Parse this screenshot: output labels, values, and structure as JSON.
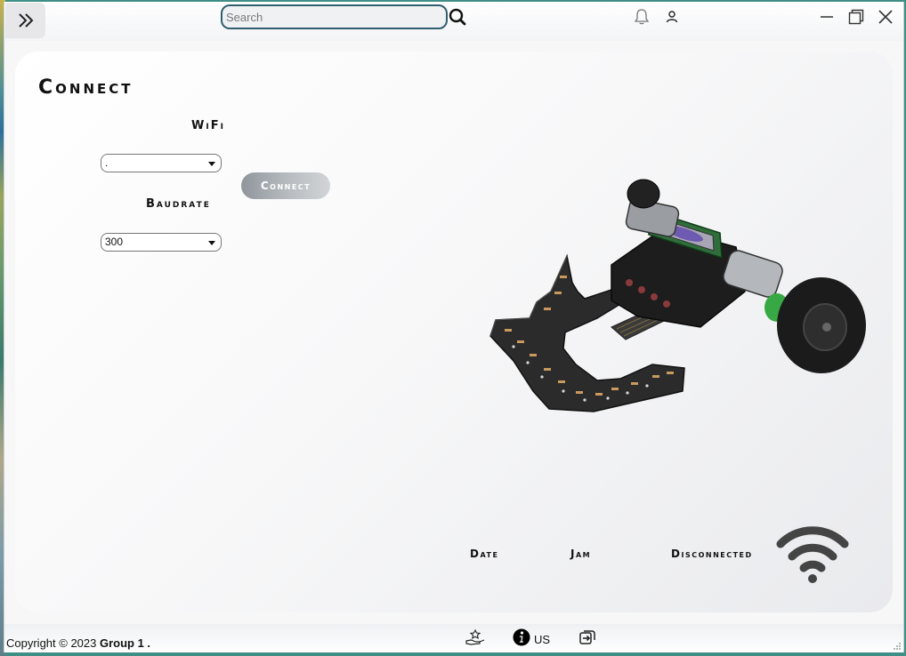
{
  "header": {
    "search_placeholder": "Search",
    "icons": [
      "menu-expand-icon",
      "search-icon",
      "bell-icon",
      "user-icon",
      "minimize-icon",
      "maximize-icon",
      "close-icon"
    ]
  },
  "connect": {
    "title": "Connect",
    "wifi_label": "WiFi",
    "wifi_value": ".",
    "baudrate_label": "Baudrate",
    "baudrate_value": "300",
    "connect_button": "Connect"
  },
  "status": {
    "date_label": "Date",
    "time_label": "Jam",
    "connection_status": "Disconnected",
    "status_icon": "wifi-icon"
  },
  "footer": {
    "copyright_prefix": "Copyright © 2023 ",
    "copyright_group": "Group 1 .",
    "about_label": "US",
    "icons": [
      "donate-icon",
      "info-icon",
      "exit-icon"
    ]
  },
  "colors": {
    "search_border": "#2f5f6f",
    "connect_button": "#a7adb2",
    "wifi_icon": "#444444"
  }
}
